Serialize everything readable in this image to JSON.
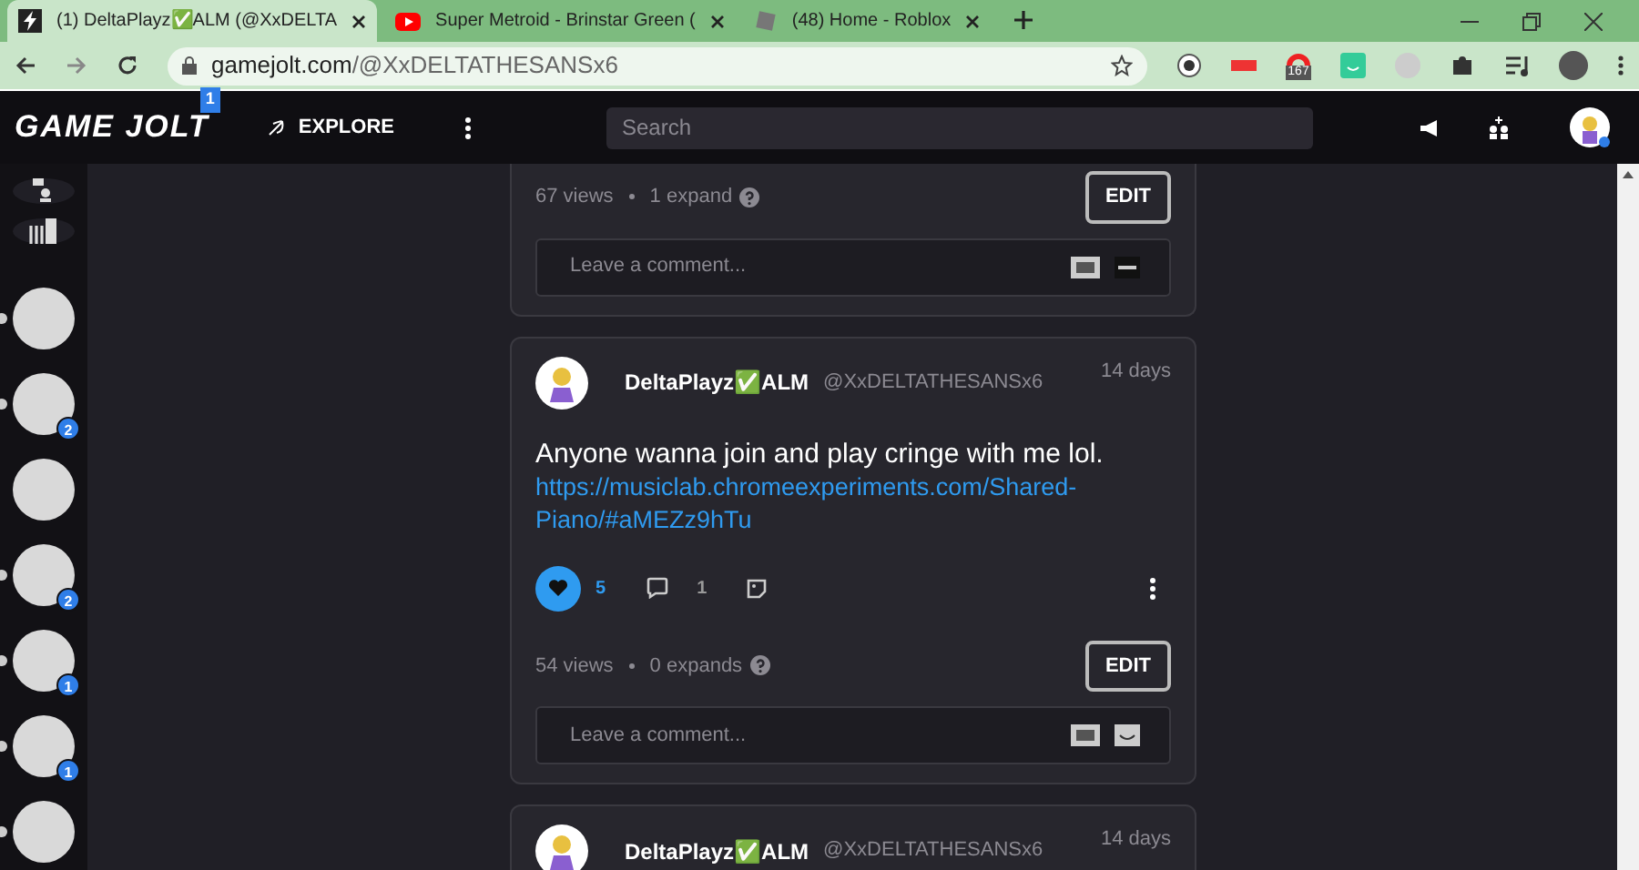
{
  "browser": {
    "tabs": [
      {
        "title": "(1) DeltaPlayz✅ALM (@XxDELTA",
        "kind": "gamejolt",
        "selected": true
      },
      {
        "title": "Super Metroid - Brinstar Green (",
        "kind": "youtube",
        "selected": false
      },
      {
        "title": "(48) Home - Roblox",
        "kind": "roblox",
        "selected": false
      }
    ],
    "url_host": "gamejolt.com",
    "url_path": "/@XxDELTATHESANSx6",
    "extension_badge": "167"
  },
  "header": {
    "logo": "GAME JOLT",
    "logo_badge": "1",
    "explore": "EXPLORE",
    "search": {
      "placeholder": "Search"
    }
  },
  "sidebar": {
    "communities": [
      {
        "unread": true
      },
      {
        "unread": true,
        "badge": "2"
      },
      {
        "unread": false
      },
      {
        "unread": true,
        "badge": "2"
      },
      {
        "unread": true,
        "badge": "1"
      },
      {
        "unread": true,
        "badge": "1"
      },
      {
        "unread": true
      }
    ]
  },
  "posts": [
    {
      "views": "67 views",
      "expands": "1 expand",
      "edit": "EDIT",
      "comment_placeholder": "Leave a comment..."
    },
    {
      "author": "DeltaPlayz✅ALM",
      "handle": "@XxDELTATHESANSx6",
      "time": "14 days",
      "text": "Anyone wanna join and play cringe with me lol.",
      "link": "https://musiclab.chromeexperiments.com/Shared-Piano/#aMEZz9hTu",
      "liked": true,
      "likes": "5",
      "comments": "1",
      "views": "54 views",
      "expands": "0 expands",
      "edit": "EDIT",
      "comment_placeholder": "Leave a comment..."
    },
    {
      "author": "DeltaPlayz✅ALM",
      "handle": "@XxDELTATHESANSx6",
      "time": "14 days"
    }
  ]
}
